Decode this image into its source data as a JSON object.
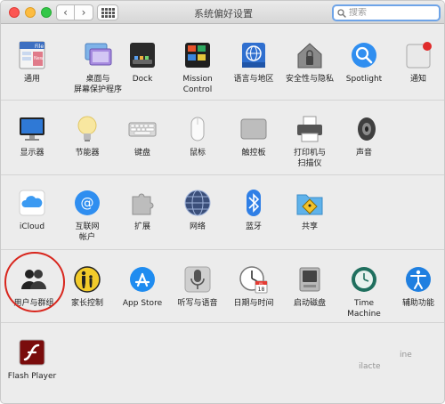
{
  "window": {
    "title": "系统偏好设置"
  },
  "search": {
    "placeholder": "搜索"
  },
  "rows": [
    [
      {
        "icon": "general-icon",
        "label": "通用"
      },
      {
        "icon": "desktop-screensaver-icon",
        "label": "桌面与\n屏幕保护程序"
      },
      {
        "icon": "dock-icon",
        "label": "Dock"
      },
      {
        "icon": "mission-control-icon",
        "label": "Mission\nControl"
      },
      {
        "icon": "language-region-icon",
        "label": "语言与地区"
      },
      {
        "icon": "security-privacy-icon",
        "label": "安全性与隐私"
      },
      {
        "icon": "spotlight-icon",
        "label": "Spotlight"
      },
      {
        "icon": "notifications-icon",
        "label": "通知"
      }
    ],
    [
      {
        "icon": "displays-icon",
        "label": "显示器"
      },
      {
        "icon": "energy-saver-icon",
        "label": "节能器"
      },
      {
        "icon": "keyboard-icon",
        "label": "键盘"
      },
      {
        "icon": "mouse-icon",
        "label": "鼠标"
      },
      {
        "icon": "trackpad-icon",
        "label": "触控板"
      },
      {
        "icon": "printers-scanners-icon",
        "label": "打印机与\n扫描仪"
      },
      {
        "icon": "sound-icon",
        "label": "声音"
      }
    ],
    [
      {
        "icon": "icloud-icon",
        "label": "iCloud"
      },
      {
        "icon": "internet-accounts-icon",
        "label": "互联网\n帐户"
      },
      {
        "icon": "extensions-icon",
        "label": "扩展"
      },
      {
        "icon": "network-icon",
        "label": "网络"
      },
      {
        "icon": "bluetooth-icon",
        "label": "蓝牙"
      },
      {
        "icon": "sharing-icon",
        "label": "共享"
      }
    ],
    [
      {
        "icon": "users-groups-icon",
        "label": "用户与群组"
      },
      {
        "icon": "parental-controls-icon",
        "label": "家长控制"
      },
      {
        "icon": "app-store-icon",
        "label": "App Store"
      },
      {
        "icon": "dictation-speech-icon",
        "label": "听写与语音"
      },
      {
        "icon": "date-time-icon",
        "label": "日期与时间"
      },
      {
        "icon": "startup-disk-icon",
        "label": "启动磁盘"
      },
      {
        "icon": "time-machine-icon",
        "label": "Time Machine"
      },
      {
        "icon": "accessibility-icon",
        "label": "辅助功能"
      }
    ],
    [
      {
        "icon": "flash-player-icon",
        "label": "Flash Player"
      }
    ]
  ],
  "calendar": {
    "month": "JUL",
    "day": "18"
  },
  "watermark": {
    "line1": "ine",
    "line2": "ilacte"
  }
}
